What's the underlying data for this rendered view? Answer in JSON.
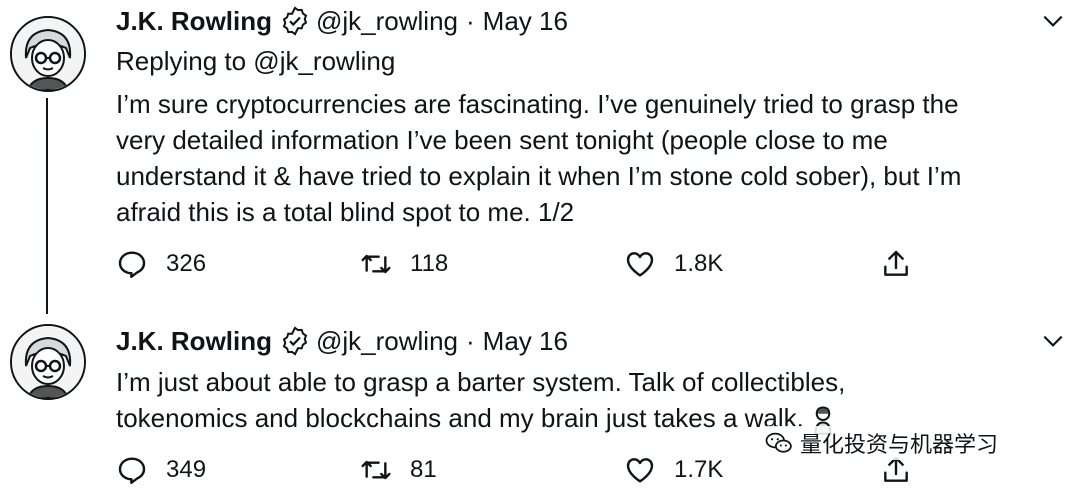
{
  "tweets": [
    {
      "author_name": "J.K. Rowling",
      "handle": "@jk_rowling",
      "separator": "·",
      "date": "May 16",
      "reply_to": "Replying to @jk_rowling",
      "lines": [
        "I’m sure cryptocurrencies are fascinating. I’ve genuinely tried to grasp the",
        "very detailed information I’ve been sent tonight (people close to me",
        "understand it & have tried to explain it when I’m stone cold sober), but I’m",
        "afraid this is a total blind spot to me. 1/2"
      ],
      "replies": "326",
      "retweets": "118",
      "likes": "1.8K"
    },
    {
      "author_name": "J.K. Rowling",
      "handle": "@jk_rowling",
      "separator": "·",
      "date": "May 16",
      "lines": [
        "I’m just about able to grasp a barter system. Talk of collectibles,",
        "tokenomics and blockchains and my brain just takes a walk."
      ],
      "emoji": "woman-walking-emoji",
      "replies": "349",
      "retweets": "81",
      "likes": "1.7K"
    }
  ],
  "icons": {
    "reply": "reply-icon",
    "retweet": "retweet-icon",
    "like": "heart-icon",
    "share": "share-icon",
    "verified": "verified-badge-icon",
    "more": "chevron-down-icon"
  },
  "watermark": {
    "text": "量化投资与机器学习",
    "icon": "wechat-icon"
  }
}
